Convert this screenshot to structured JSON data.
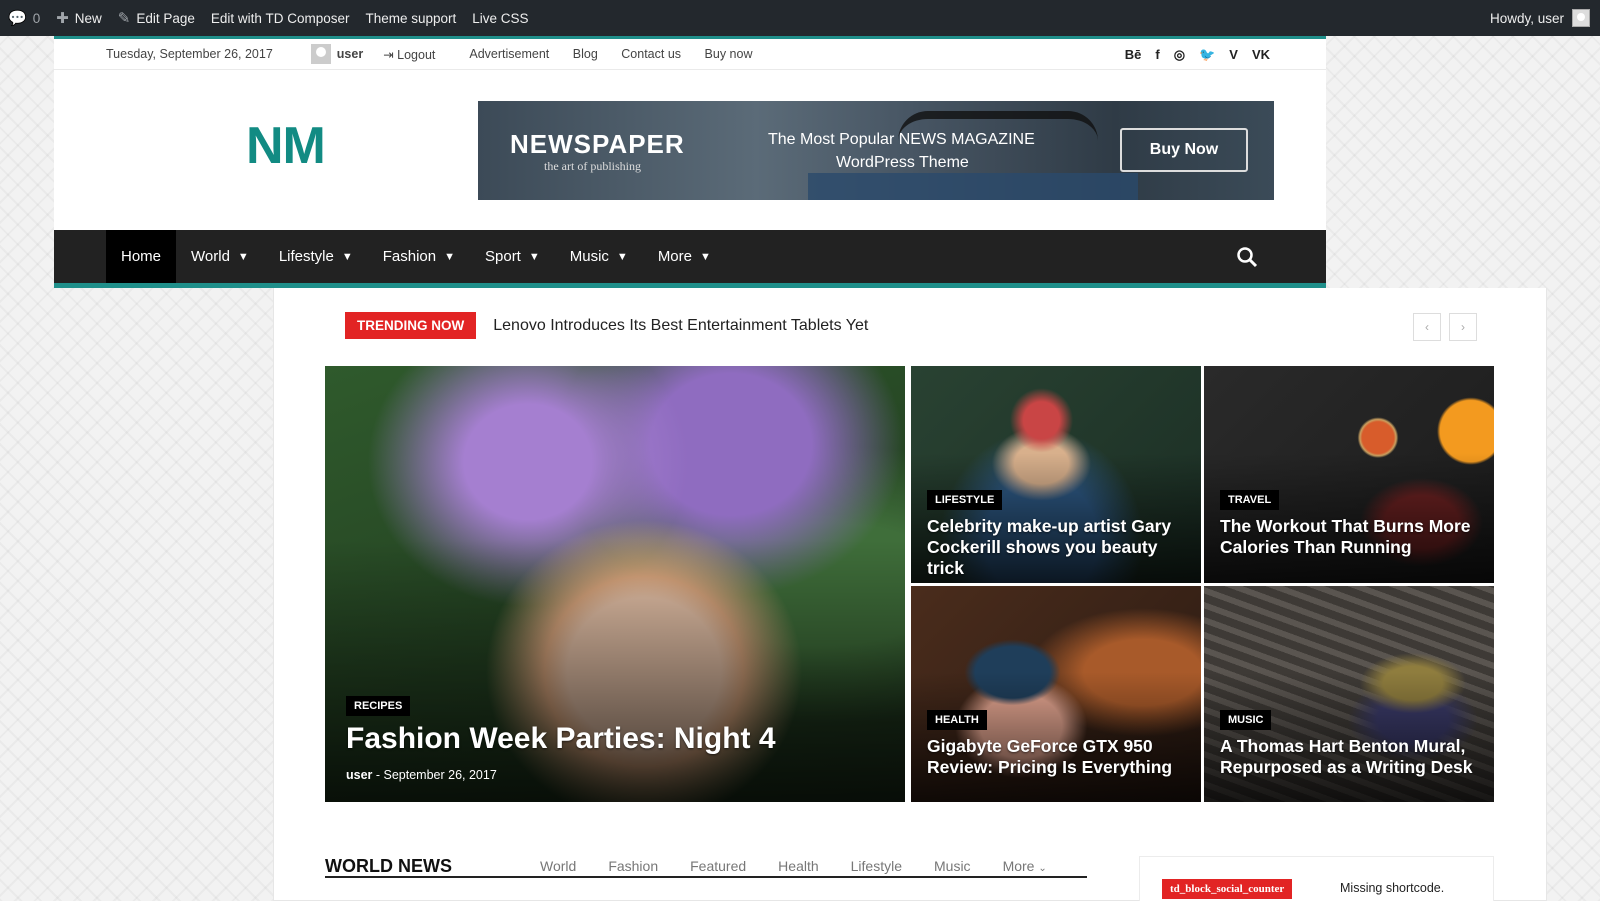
{
  "adminbar": {
    "comments": "0",
    "new": "New",
    "edit_page": "Edit Page",
    "edit_td": "Edit with TD Composer",
    "theme_support": "Theme support",
    "live_css": "Live CSS",
    "howdy": "Howdy, user"
  },
  "topbar": {
    "date": "Tuesday, September 26, 2017",
    "user": "user",
    "logout": "Logout",
    "menu": [
      "Advertisement",
      "Blog",
      "Contact us",
      "Buy now"
    ],
    "social": [
      "Bē",
      "f",
      "◎",
      "🐦",
      "V",
      "VK"
    ]
  },
  "logo": "NM",
  "banner": {
    "title": "NEWSPAPER",
    "subtitle": "the art of publishing",
    "line1": "The Most Popular NEWS MAGAZINE",
    "line2": "WordPress Theme",
    "button": "Buy Now"
  },
  "nav": {
    "items": [
      "Home",
      "World",
      "Lifestyle",
      "Fashion",
      "Sport",
      "Music",
      "More"
    ]
  },
  "trending": {
    "badge": "TRENDING NOW",
    "text": "Lenovo Introduces Its Best Entertainment Tablets Yet",
    "prev": "‹",
    "next": "›"
  },
  "tiles": [
    {
      "category": "RECIPES",
      "title": "Fashion Week Parties: Night 4",
      "author": "user",
      "date": "September 26, 2017"
    },
    {
      "category": "LIFESTYLE",
      "title": "Celebrity make-up artist Gary Cockerill shows you beauty trick"
    },
    {
      "category": "TRAVEL",
      "title": "The Workout That Burns More Calories Than Running"
    },
    {
      "category": "HEALTH",
      "title": "Gigabyte GeForce GTX 950 Review: Pricing Is Everything"
    },
    {
      "category": "MUSIC",
      "title": "A Thomas Hart Benton Mural, Repurposed as a Writing Desk"
    }
  ],
  "world_news": {
    "title": "WORLD NEWS",
    "tabs": [
      "World",
      "Fashion",
      "Featured",
      "Health",
      "Lifestyle",
      "Music",
      "More"
    ]
  },
  "sidebar": {
    "badge": "td_block_social_counter",
    "text": "Missing shortcode."
  },
  "colors": {
    "accent": "#1f8f8a",
    "trending": "#e22424",
    "navbar": "#222222",
    "adminbar": "#23282d"
  }
}
